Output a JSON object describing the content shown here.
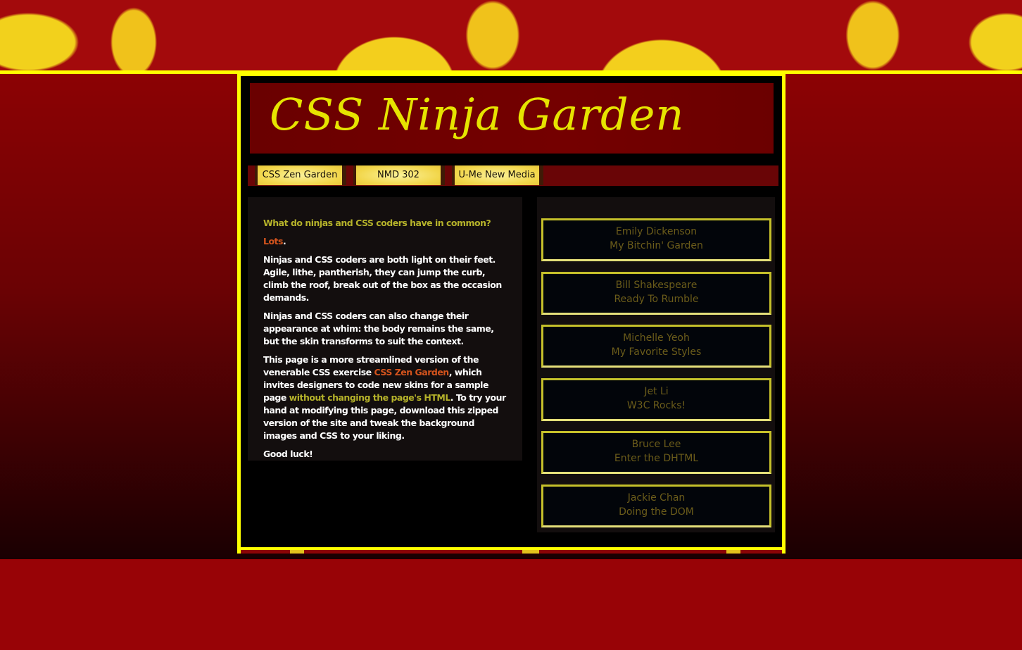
{
  "site": {
    "title": "CSS Ninja Garden"
  },
  "nav": {
    "items": [
      {
        "label": "CSS Zen Garden"
      },
      {
        "label": "NMD 302"
      },
      {
        "label": "U-Me New Media"
      }
    ]
  },
  "main": {
    "question": "What do ninjas and CSS coders have in common?",
    "lots": "Lots",
    "lots_period": ".",
    "para1": "Ninjas and CSS coders are both light on their feet. Agile, lithe, pantherish, they can jump the curb, climb the roof, break out of the box as the occasion demands.",
    "para2": "Ninjas and CSS coders can also change their appearance at whim: the body remains the same, but the skin transforms to suit the context.",
    "para3_a": "This page is a more streamlined version of the venerable CSS exercise ",
    "para3_link1": "CSS Zen Garden",
    "para3_b": ", which invites designers to code new skins for a sample page ",
    "para3_link2": "without changing the page's HTML",
    "para3_c": ". To try your hand at modifying this page, download this zipped version of the site and tweak the background images and CSS to your liking.",
    "closing": "Good luck!"
  },
  "sidebar": {
    "designs": [
      {
        "author": "Emily Dickenson",
        "title": "My Bitchin' Garden"
      },
      {
        "author": "Bill Shakespeare",
        "title": "Ready To Rumble"
      },
      {
        "author": "Michelle Yeoh",
        "title": "My Favorite Styles"
      },
      {
        "author": "Jet Li",
        "title": "W3C Rocks!"
      },
      {
        "author": "Bruce Lee",
        "title": "Enter the DHTML"
      },
      {
        "author": "Jackie Chan",
        "title": "Doing the DOM"
      }
    ]
  },
  "colors": {
    "accent_yellow": "#ffff00",
    "title_yellow": "#e6e400",
    "background_red": "#980306",
    "link_orange": "#d5541d",
    "link_olive": "#b5b22a"
  }
}
